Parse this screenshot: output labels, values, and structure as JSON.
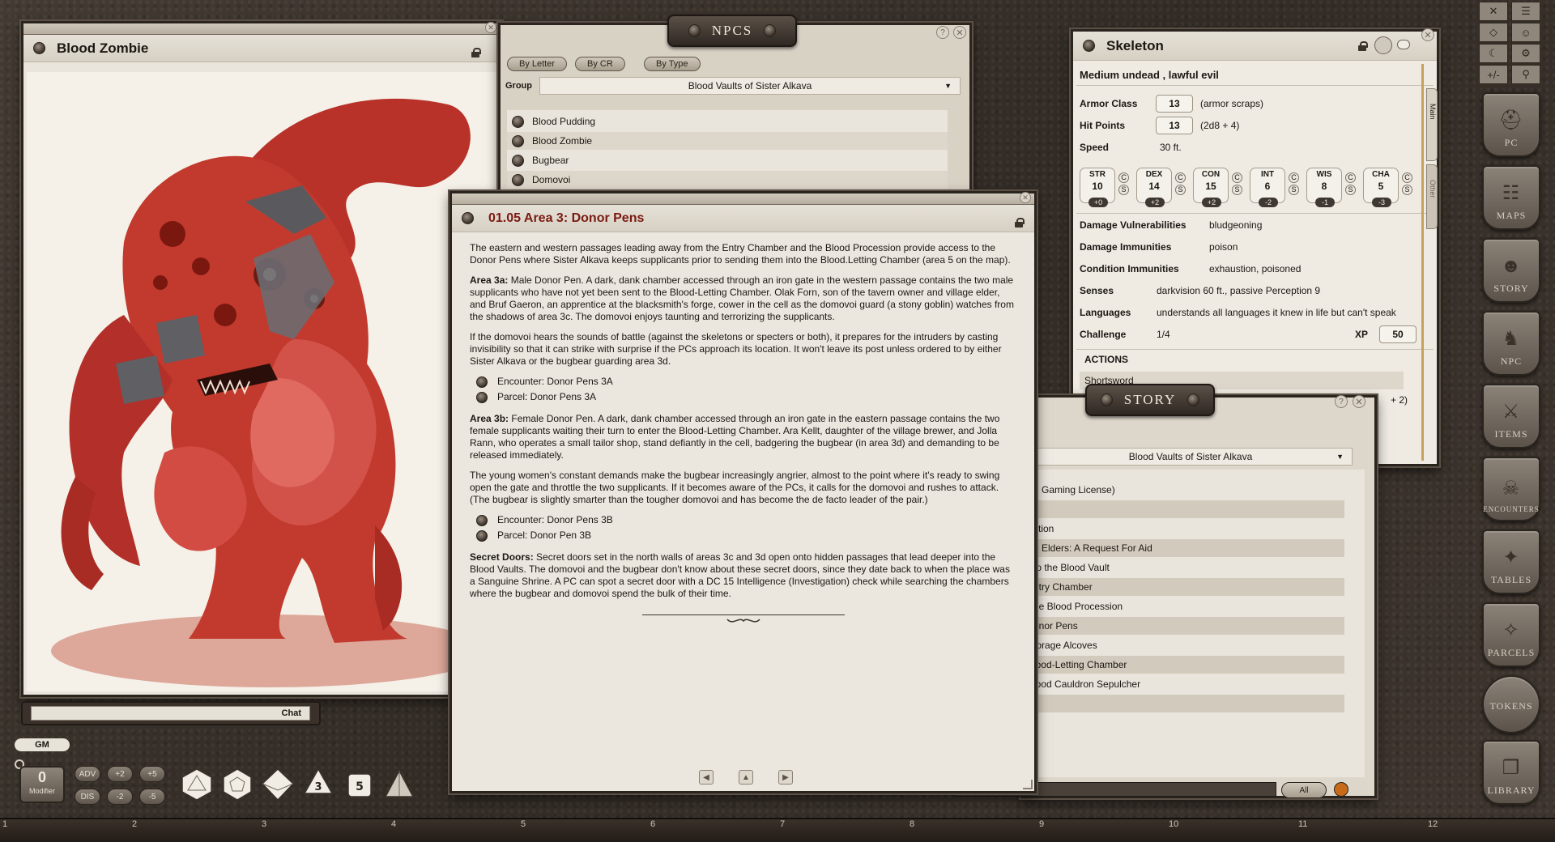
{
  "image_window": {
    "title": "Blood Zombie"
  },
  "chat": {
    "label": "Chat",
    "gm_label": "GM"
  },
  "modifier": {
    "value": "0",
    "label": "Modifier",
    "buttons": [
      "ADV",
      "+2",
      "+5",
      "DIS",
      "-2",
      "-5"
    ]
  },
  "dice": [
    "d20",
    "d12",
    "d10",
    "d8",
    "d6",
    "d4"
  ],
  "dice_faces": [
    "3",
    "5"
  ],
  "npcs": {
    "title": "NPCS",
    "tabs": [
      "By Letter",
      "By CR",
      "By Type"
    ],
    "group_label": "Group",
    "group_value": "Blood Vaults of Sister Alkava",
    "items": [
      "Blood Pudding",
      "Blood Zombie",
      "Bugbear",
      "Domovoi"
    ]
  },
  "story_entry": {
    "title": "01.05 Area 3: Donor Pens",
    "p1": "The eastern and western passages leading away from the Entry Chamber and the Blood Procession provide access to the Donor Pens where Sister Alkava keeps supplicants prior to sending them into the Blood.Letting Chamber (area 5 on the map).",
    "p2_label": "Area 3a:",
    "p2": " Male Donor Pen. A dark, dank chamber accessed through an iron gate in the western passage contains the two male supplicants who have not yet been sent to the Blood-Letting Chamber. Olak Forn, son of the tavern owner and village elder, and Bruf Gaeron, an apprentice at the blacksmith's forge, cower in the cell as the domovoi guard (a stony goblin) watches from the shadows of area 3c. The domovoi enjoys taunting and terrorizing the supplicants.",
    "p3": "If the domovoi hears the sounds of battle (against the skeletons or specters or both), it prepares for the intruders by casting invisibility so that it can strike with surprise if the PCs approach its location. It won't leave its post unless ordered to by either Sister Alkava or the bugbear guarding area 3d.",
    "links_a": [
      "Encounter: Donor Pens 3A",
      "Parcel: Donor Pens 3A"
    ],
    "p4_label": "Area 3b:",
    "p4": " Female Donor Pen. A dark, dank chamber accessed through an iron gate in the eastern passage contains the two female supplicants waiting their turn to enter the Blood-Letting Chamber. Ara Kellt, daughter of the village brewer, and Jolla Rann, who operates a small tailor shop, stand defiantly in the cell, badgering the bugbear (in area 3d) and demanding to be released immediately.",
    "p5": "The young women's constant demands make the bugbear increasingly angrier, almost to the point where it's ready to swing open the gate and throttle the two supplicants. If it becomes aware of the PCs, it calls for the domovoi and rushes to attack. (The bugbear is slightly smarter than the tougher domovoi and has become the de facto leader of the pair.)",
    "links_b": [
      "Encounter: Donor Pens 3B",
      "Parcel: Donor Pen 3B"
    ],
    "p6_label": "Secret Doors:",
    "p6": " Secret doors set in the north walls of areas 3c and 3d open onto hidden passages that lead deeper into the Blood Vaults. The domovoi and the bugbear don't know about these secret doors, since they date back to when the place was a Sanguine Shrine. A PC can spot a secret door with a DC 15 Intelligence (Investigation) check while searching the chambers where the bugbear and domovoi spend the bulk of their time."
  },
  "skeleton": {
    "title": "Skeleton",
    "subtitle": "Medium undead , lawful evil",
    "ac_label": "Armor Class",
    "ac": "13",
    "ac_note": "(armor scraps)",
    "hp_label": "Hit Points",
    "hp": "13",
    "hp_note": "(2d8 + 4)",
    "speed_label": "Speed",
    "speed": "30 ft.",
    "abilities": [
      {
        "name": "STR",
        "score": "10",
        "mod": "+0"
      },
      {
        "name": "DEX",
        "score": "14",
        "mod": "+2"
      },
      {
        "name": "CON",
        "score": "15",
        "mod": "+2"
      },
      {
        "name": "INT",
        "score": "6",
        "mod": "-2"
      },
      {
        "name": "WIS",
        "score": "8",
        "mod": "-1"
      },
      {
        "name": "CHA",
        "score": "5",
        "mod": "-3"
      }
    ],
    "cs": [
      "C",
      "S"
    ],
    "dv_label": "Damage Vulnerabilities",
    "dv": "bludgeoning",
    "di_label": "Damage Immunities",
    "di": "poison",
    "ci_label": "Condition Immunities",
    "ci": "exhaustion, poisoned",
    "senses_label": "Senses",
    "senses": "darkvision 60 ft., passive Perception 9",
    "lang_label": "Languages",
    "lang": "understands all languages it knew in life but can't speak",
    "cr_label": "Challenge",
    "cr": "1/4",
    "xp_label": "XP",
    "xp": "50",
    "actions_label": "ACTIONS",
    "action1": "Shortsword",
    "action_tail": "+ 2)",
    "side_tabs": [
      "Main",
      "Other"
    ]
  },
  "story_list": {
    "title": "STORY",
    "group_value": "Blood Vaults of Sister Alkava",
    "items": [
      "n Gaming License)",
      "",
      "ction",
      "e Elders: A Request For Aid",
      "to the Blood Vault",
      "ntry Chamber",
      "he Blood Procession",
      "onor Pens",
      "torage Alcoves",
      "lood-Letting Chamber",
      "lood Cauldron Sepulcher",
      "n"
    ],
    "filter_label": "All"
  },
  "sidebar": {
    "tools_row1": [
      "✕",
      "☰"
    ],
    "tools_row2": [
      "◇",
      "☺"
    ],
    "tools_row3": [
      "☾",
      "⚙"
    ],
    "tools_row4": [
      "+/-",
      "⚲"
    ],
    "buttons": [
      "PC",
      "MAPS",
      "STORY",
      "NPC",
      "ITEMS",
      "ENCOUNTERS",
      "TABLES",
      "PARCELS",
      "TOKENS",
      "LIBRARY"
    ]
  },
  "hotbar": {
    "numbers": [
      "1",
      "2",
      "3",
      "4",
      "5",
      "6",
      "7",
      "8",
      "9",
      "10",
      "11",
      "12"
    ]
  }
}
